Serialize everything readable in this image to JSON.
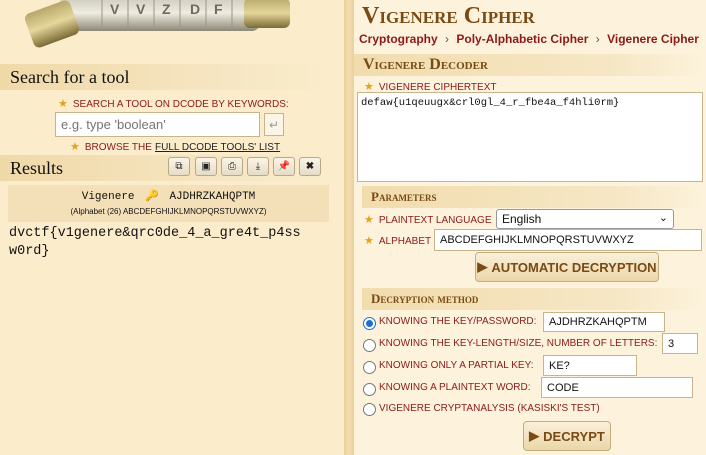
{
  "left": {
    "search": {
      "heading": "Search for a tool",
      "keywords_label": "SEARCH A TOOL ON DCODE BY KEYWORDS:",
      "placeholder": "e.g. type 'boolean'",
      "go_icon": "enter-icon",
      "browse_prefix": "BROWSE THE",
      "browse_link": "FULL DCODE TOOLS' LIST"
    },
    "results": {
      "heading": "Results",
      "toolbar_icons": [
        "copy-icon",
        "save-icon",
        "print-icon",
        "download-icon",
        "pin-icon",
        "close-icon"
      ],
      "result_title": "Vigenere",
      "key": "AJDHRZKAHQPTM",
      "alphabet_line": "(Alphabet (26) ABCDEFGHIJKLMNOPQRSTUVWXYZ)",
      "output_line1": "dvctf{v1genere&qrc0de_4_a_gre4t_p4ss",
      "output_line2": "w0rd}"
    }
  },
  "right": {
    "title": "Vigenere Cipher",
    "breadcrumb": [
      "Cryptography",
      "Poly-Alphabetic Cipher",
      "Vigenere Cipher"
    ],
    "decoder_heading": "Vigenere Decoder",
    "ciphertext_label": "VIGENERE CIPHERTEXT",
    "ciphertext": "defaw{u1qeuugx&crl0gl_4_r_fbe4a_f4hli0rm}",
    "parameters_heading": "Parameters",
    "plaintext_language_label": "PLAINTEXT LANGUAGE",
    "plaintext_language": "English",
    "alphabet_label": "ALPHABET",
    "alphabet": "ABCDEFGHIJKLMNOPQRSTUVWXYZ",
    "auto_decrypt_label": "AUTOMATIC DECRYPTION",
    "method_heading": "Decryption method",
    "options": {
      "key": {
        "label": "KNOWING THE KEY/PASSWORD:",
        "value": "AJDHRZKAHQPTM",
        "selected": true
      },
      "key_length": {
        "label": "KNOWING THE KEY-LENGTH/SIZE, NUMBER OF LETTERS:",
        "value": "3"
      },
      "partial_key": {
        "label": "KNOWING ONLY A PARTIAL KEY:",
        "value": "KE?"
      },
      "plaintext_word": {
        "label": "KNOWING A PLAINTEXT WORD:",
        "value": "CODE"
      },
      "cryptanalysis": {
        "label": "VIGENERE CRYPTANALYSIS (KASISKI'S TEST)"
      }
    },
    "decrypt_label": "DECRYPT"
  },
  "colors": {
    "accent_red": "#8b1a1a",
    "heading_brown": "#7a4a14",
    "star": "#e2a21a",
    "radio_blue": "#1f6fd1"
  }
}
